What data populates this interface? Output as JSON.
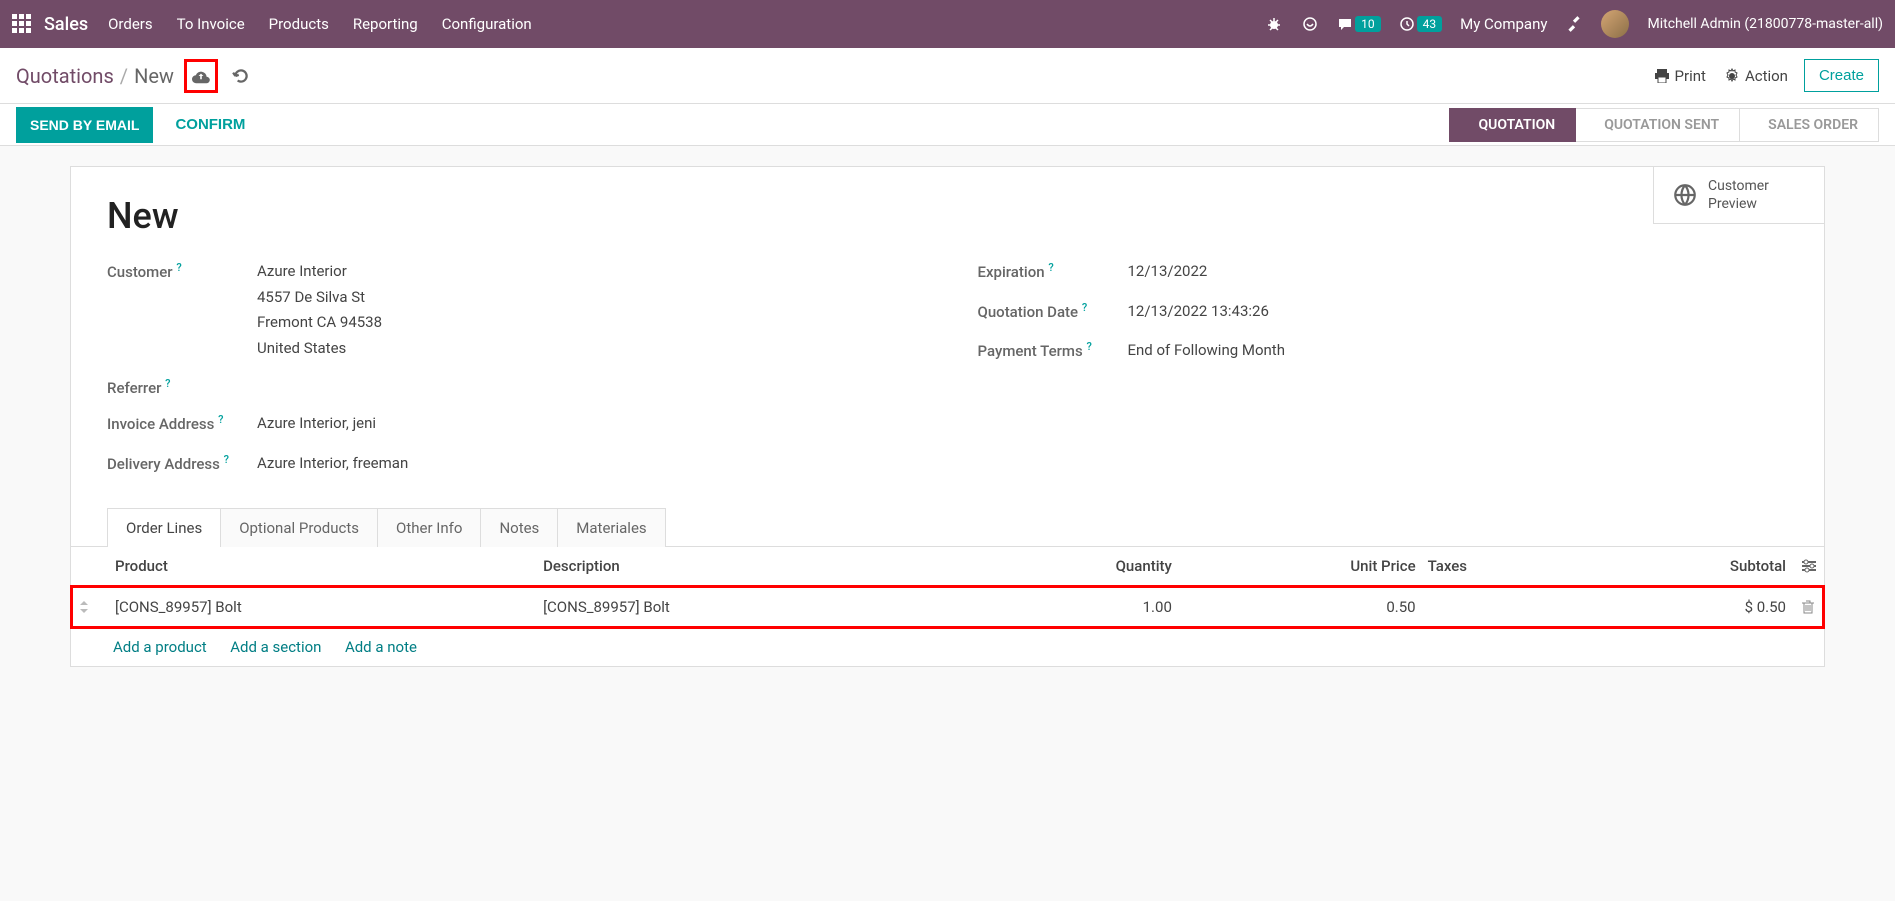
{
  "topnav": {
    "brand": "Sales",
    "menu": [
      "Orders",
      "To Invoice",
      "Products",
      "Reporting",
      "Configuration"
    ],
    "messages_badge": "10",
    "activities_badge": "43",
    "company": "My Company",
    "username": "Mitchell Admin (21800778-master-all)"
  },
  "breadcrumb": {
    "parent": "Quotations",
    "current": "New",
    "print": "Print",
    "action": "Action",
    "create": "Create"
  },
  "statusbar": {
    "send_email": "SEND BY EMAIL",
    "confirm": "CONFIRM",
    "stages": [
      "QUOTATION",
      "QUOTATION SENT",
      "SALES ORDER"
    ]
  },
  "button_box": {
    "customer_preview": "Customer\nPreview"
  },
  "form": {
    "title": "New",
    "customer_label": "Customer",
    "customer_name": "Azure Interior",
    "customer_addr1": "4557 De Silva St",
    "customer_addr2": "Fremont CA 94538",
    "customer_addr3": "United States",
    "referrer_label": "Referrer",
    "referrer_value": "",
    "invoice_addr_label": "Invoice Address",
    "invoice_addr_value": "Azure Interior, jeni",
    "delivery_addr_label": "Delivery Address",
    "delivery_addr_value": "Azure Interior, freeman",
    "expiration_label": "Expiration",
    "expiration_value": "12/13/2022",
    "quotation_date_label": "Quotation Date",
    "quotation_date_value": "12/13/2022 13:43:26",
    "payment_terms_label": "Payment Terms",
    "payment_terms_value": "End of Following Month"
  },
  "tabs": [
    "Order Lines",
    "Optional Products",
    "Other Info",
    "Notes",
    "Materiales"
  ],
  "table": {
    "headers": {
      "product": "Product",
      "description": "Description",
      "quantity": "Quantity",
      "unit_price": "Unit Price",
      "taxes": "Taxes",
      "subtotal": "Subtotal"
    },
    "row": {
      "product": "[CONS_89957] Bolt",
      "description": "[CONS_89957] Bolt",
      "quantity": "1.00",
      "unit_price": "0.50",
      "taxes": "",
      "subtotal": "$ 0.50"
    },
    "add_product": "Add a product",
    "add_section": "Add a section",
    "add_note": "Add a note"
  }
}
